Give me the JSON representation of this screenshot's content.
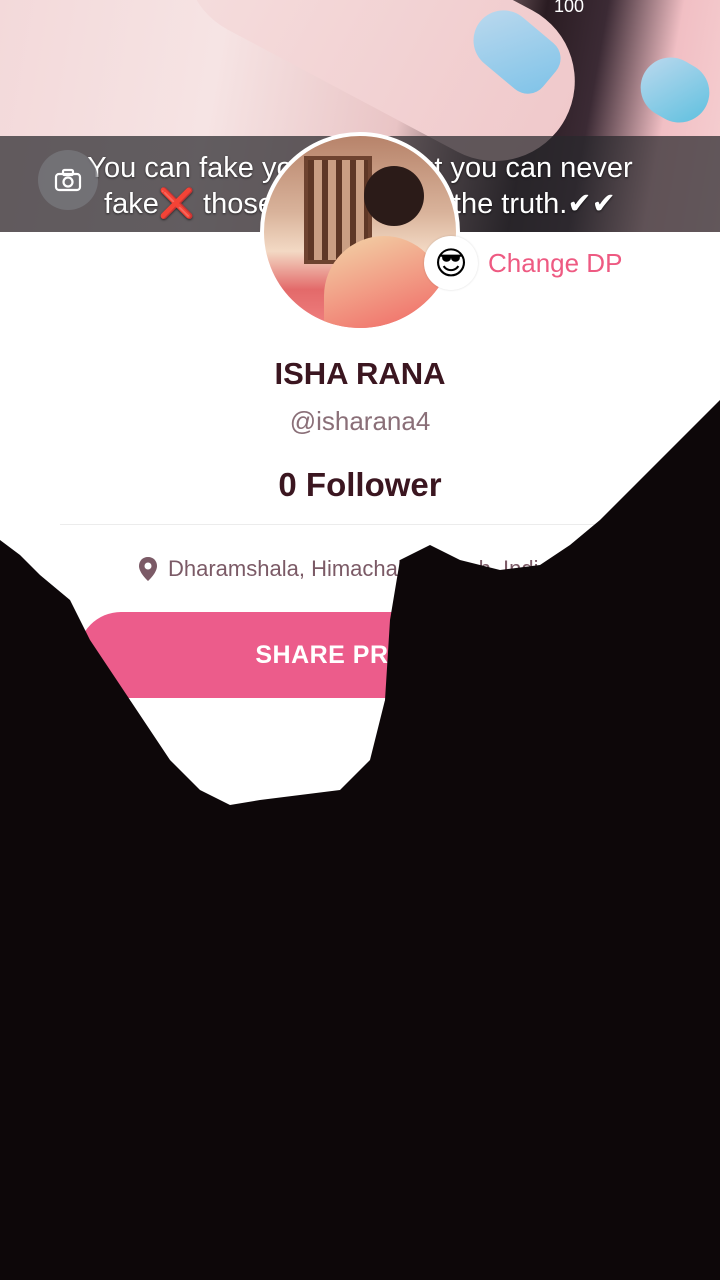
{
  "cover": {
    "counter": "100",
    "quote_line1": "You can fake your smile but you can never",
    "quote_line2": "fake❌ those eyes that tell the truth.✔✔"
  },
  "profile": {
    "change_dp_emoji": "😎",
    "change_dp_label": "Change DP",
    "name": "ISHA RANA",
    "handle": "@isharana4",
    "followers": "0 Follower",
    "location": "Dharamshala, Himachal Pradesh, India",
    "share_label": "SHARE PROFILE"
  },
  "colors": {
    "accent_pink": "#ec5c8b",
    "name_color": "#3b1620",
    "overlay_dark": "#0d0709"
  },
  "icons": {
    "camera": "camera-icon",
    "location": "location-pin-icon"
  }
}
